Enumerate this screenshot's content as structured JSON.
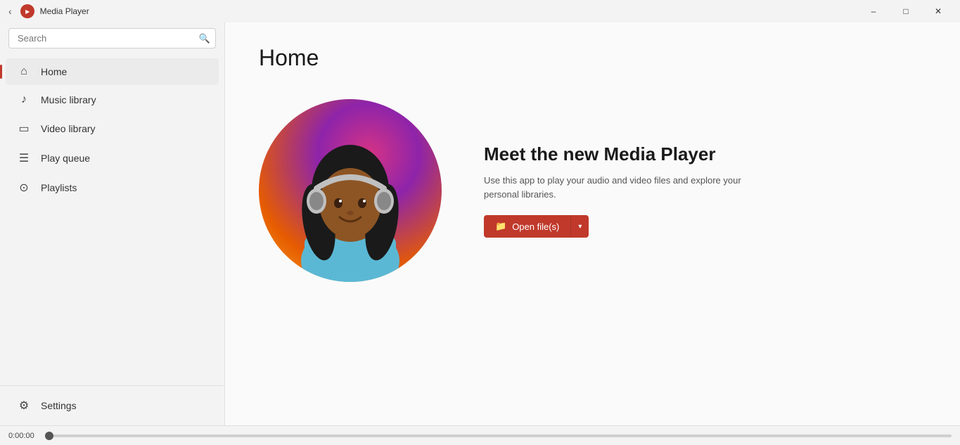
{
  "titleBar": {
    "title": "Media Player",
    "minLabel": "–",
    "maxLabel": "□",
    "closeLabel": "✕"
  },
  "search": {
    "placeholder": "Search",
    "value": ""
  },
  "nav": {
    "items": [
      {
        "id": "home",
        "label": "Home",
        "icon": "⌂",
        "active": true
      },
      {
        "id": "music-library",
        "label": "Music library",
        "icon": "♪",
        "active": false
      },
      {
        "id": "video-library",
        "label": "Video library",
        "icon": "▭",
        "active": false
      },
      {
        "id": "play-queue",
        "label": "Play queue",
        "icon": "☰",
        "active": false
      },
      {
        "id": "playlists",
        "label": "Playlists",
        "icon": "⊙",
        "active": false
      }
    ],
    "settings": {
      "label": "Settings",
      "icon": "⚙"
    }
  },
  "main": {
    "pageTitle": "Home",
    "hero": {
      "heading": "Meet the new Media Player",
      "description": "Use this app to play your audio and video files and explore your personal libraries.",
      "openButtonLabel": "Open file(s)",
      "openArrow": "▾"
    }
  },
  "progressBar": {
    "timeLabel": "0:00:00"
  }
}
